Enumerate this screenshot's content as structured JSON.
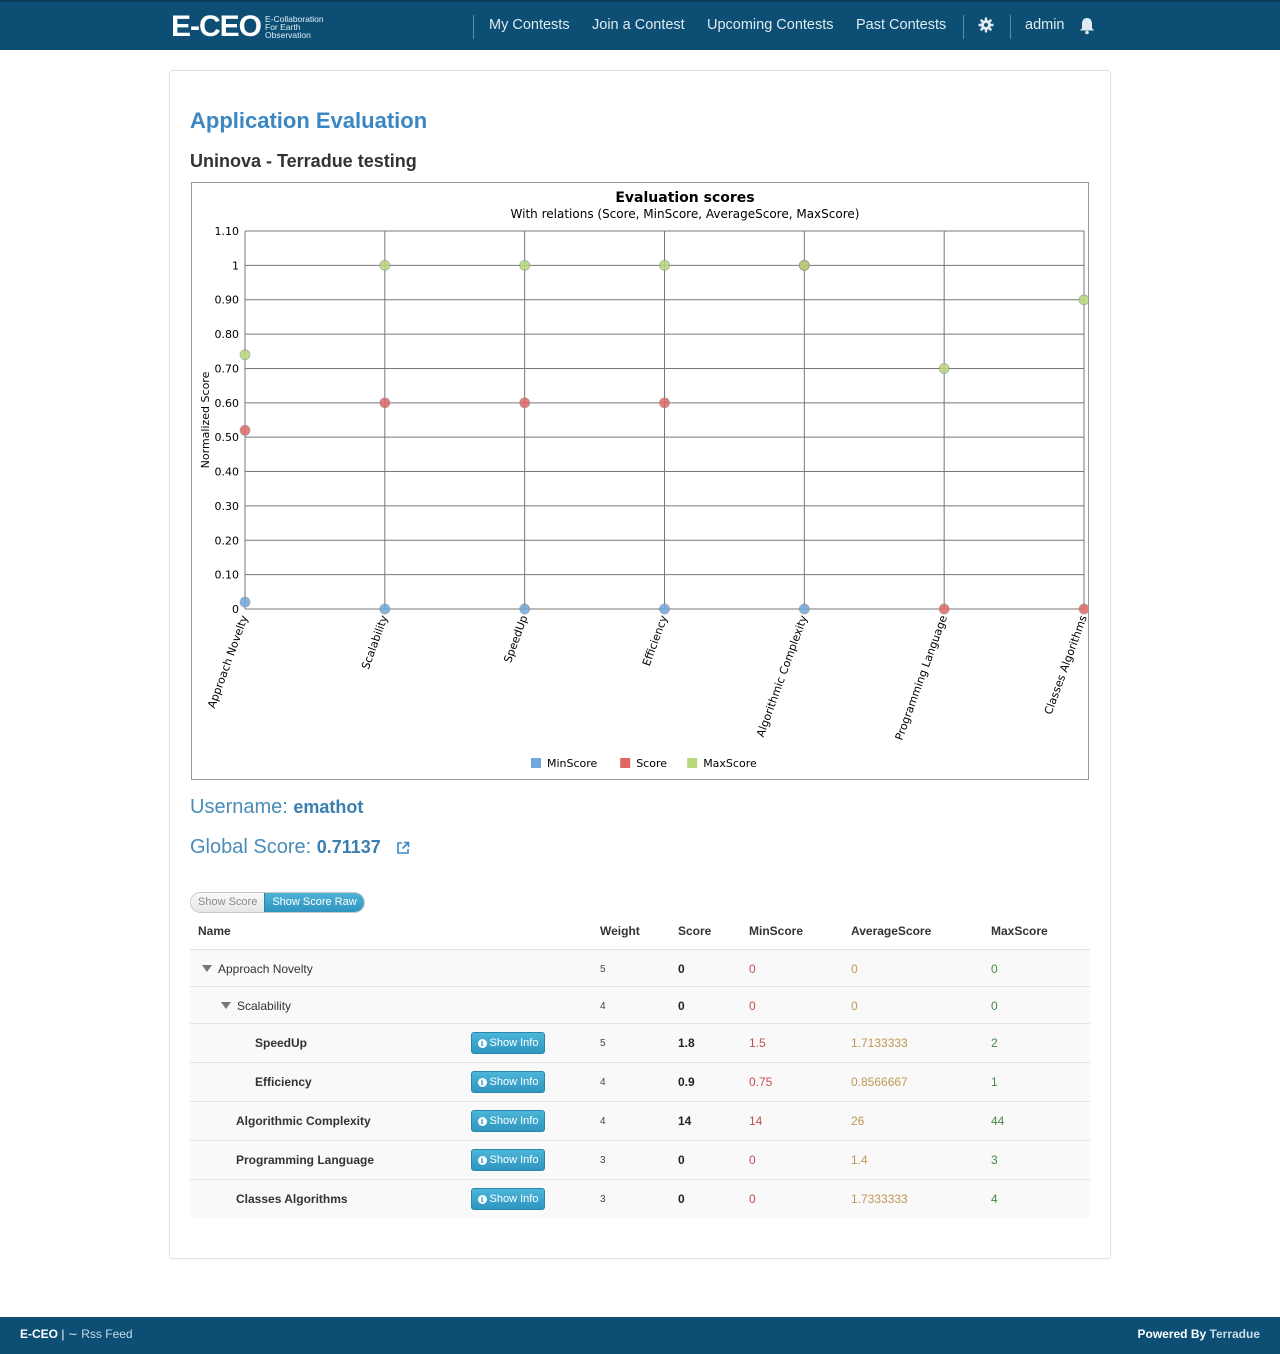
{
  "nav": {
    "logo": "E-CEO",
    "logo_sub": "E-Collaboration For Earth Observation",
    "items": [
      "My Contests",
      "Join a Contest",
      "Upcoming Contests",
      "Past Contests"
    ],
    "user": "admin",
    "icons": [
      "gear-icon",
      "bell-icon"
    ]
  },
  "page": {
    "title": "Application Evaluation",
    "subtitle": "Uninova - Terradue testing",
    "username_label": "Username:",
    "username": "emathot",
    "global_label": "Global Score:",
    "global_value": "0.71137"
  },
  "chart_data": {
    "type": "scatter",
    "title": "Evaluation scores",
    "subtitle": "With relations (Score, MinScore, AverageScore, MaxScore)",
    "ylabel": "Normalized Score",
    "xlabel": "",
    "ylim": [
      0,
      1.1
    ],
    "yticks": [
      "0",
      "0.10",
      "0.20",
      "0.30",
      "0.40",
      "0.50",
      "0.60",
      "0.70",
      "0.80",
      "0.90",
      "1",
      "1.10"
    ],
    "categories": [
      "Approach Novelty",
      "Scalability",
      "SpeedUp",
      "Efficiency",
      "Algorithmic Complexity",
      "Programming Language",
      "Classes Algorithms"
    ],
    "series": [
      {
        "name": "MinScore",
        "color": "#6fa8dc",
        "values": [
          0.02,
          0,
          0,
          0,
          0,
          null,
          null
        ]
      },
      {
        "name": "Score",
        "color": "#e06666",
        "values": [
          0.52,
          0.6,
          0.6,
          0.6,
          1,
          0,
          0
        ]
      },
      {
        "name": "MaxScore",
        "color": "#b6d77a",
        "values": [
          0.74,
          1,
          1,
          1,
          1,
          0.7,
          0.9
        ]
      }
    ],
    "legend": "bottom-center",
    "grid": true
  },
  "toggle": {
    "show_score": "Show Score",
    "show_score_raw": "Show Score Raw"
  },
  "table": {
    "headers": [
      "Name",
      "Weight",
      "Score",
      "MinScore",
      "AverageScore",
      "MaxScore"
    ],
    "button_label": "Show Info",
    "rows": [
      {
        "name": "Approach Novelty",
        "weight": "5",
        "score": "0",
        "min": "0",
        "avg": "0",
        "max": "0"
      },
      {
        "name": "Scalability",
        "weight": "4",
        "score": "0",
        "min": "0",
        "avg": "0",
        "max": "0"
      },
      {
        "name": "SpeedUp",
        "weight": "5",
        "score": "1.8",
        "min": "1.5",
        "avg": "1.7133333",
        "max": "2"
      },
      {
        "name": "Efficiency",
        "weight": "4",
        "score": "0.9",
        "min": "0.75",
        "avg": "0.8566667",
        "max": "1"
      },
      {
        "name": "Algorithmic Complexity",
        "weight": "4",
        "score": "14",
        "min": "14",
        "avg": "26",
        "max": "44"
      },
      {
        "name": "Programming Language",
        "weight": "3",
        "score": "0",
        "min": "0",
        "avg": "1.4",
        "max": "3"
      },
      {
        "name": "Classes Algorithms",
        "weight": "3",
        "score": "0",
        "min": "0",
        "avg": "1.7333333",
        "max": "4"
      }
    ]
  },
  "footer": {
    "brand": "E-CEO",
    "sep": "|",
    "rss": "Rss Feed",
    "powered": "Powered By",
    "company": "Terradue"
  }
}
